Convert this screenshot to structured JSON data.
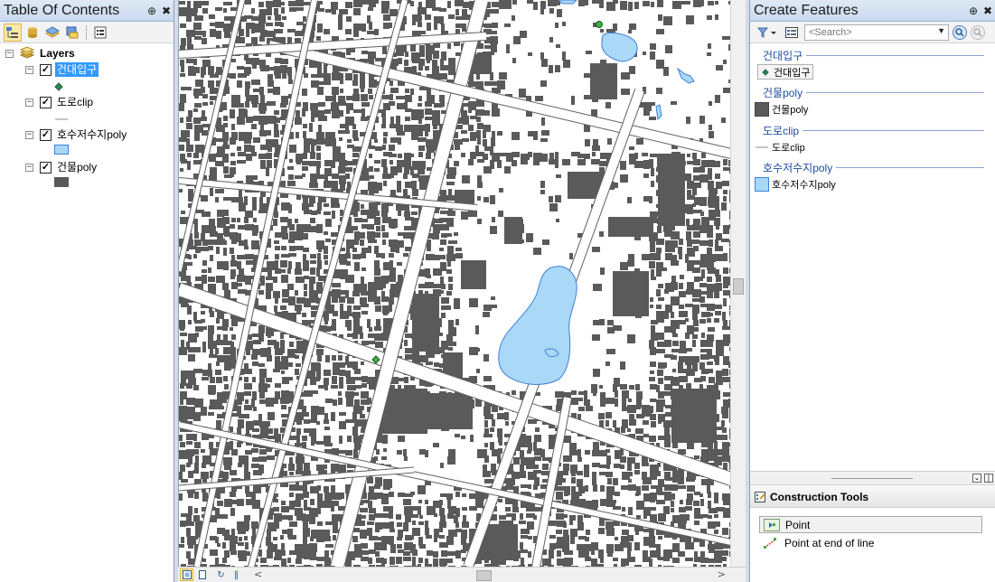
{
  "toc": {
    "title": "Table Of Contents",
    "pin_glyph": "⊕",
    "close_glyph": "✖",
    "toolbar_icons": [
      "list-by-drawing-order-icon",
      "list-by-source-icon",
      "list-by-visibility-icon",
      "list-by-selection-icon",
      "options-icon"
    ],
    "root_label": "Layers",
    "layers": [
      {
        "name": "건대입구",
        "checked": true,
        "selected": true,
        "symbol": "point",
        "symbol_color": "#2e8b57"
      },
      {
        "name": "도로clip",
        "checked": true,
        "selected": false,
        "symbol": "line",
        "symbol_color": "#8c8c8c"
      },
      {
        "name": "호수저수지poly",
        "checked": true,
        "selected": false,
        "symbol": "polygon",
        "symbol_color": "#a8d8f5"
      },
      {
        "name": "건물poly",
        "checked": true,
        "selected": false,
        "symbol": "polygon",
        "symbol_color": "#595959"
      }
    ]
  },
  "map": {
    "background": "#ffffff",
    "building_color": "#5a5a5a",
    "water_color": "#aad8f7",
    "water_outline": "#3b7fd9",
    "road_color": "#ffffff",
    "road_edge": "#606060",
    "entrance_color": "#3cb043"
  },
  "map_footer": {
    "layout_view_icon": "data-view-icon",
    "page_icon": "layout-view-icon",
    "refresh_glyph": "↻",
    "pause_glyph": "‖",
    "left_arrow": "<",
    "right_arrow": ">"
  },
  "create_features": {
    "title": "Create Features",
    "pin_glyph": "⊕",
    "close_glyph": "✖",
    "search_placeholder": "<Search>",
    "groups": [
      {
        "header": "건대입구",
        "item": "건대입구",
        "symbol": "point",
        "selected": true
      },
      {
        "header": "건물poly",
        "item": "건물poly",
        "symbol": "polygon-dark",
        "selected": false
      },
      {
        "header": "도로clip",
        "item": "도로clip",
        "symbol": "line",
        "selected": false
      },
      {
        "header": "호수저수지poly",
        "item": "호수저수지poly",
        "symbol": "polygon-water",
        "selected": false
      }
    ],
    "construction_tools_title": "Construction Tools",
    "tools": [
      {
        "label": "Point",
        "selected": true
      },
      {
        "label": "Point at end of line",
        "selected": false
      }
    ]
  }
}
